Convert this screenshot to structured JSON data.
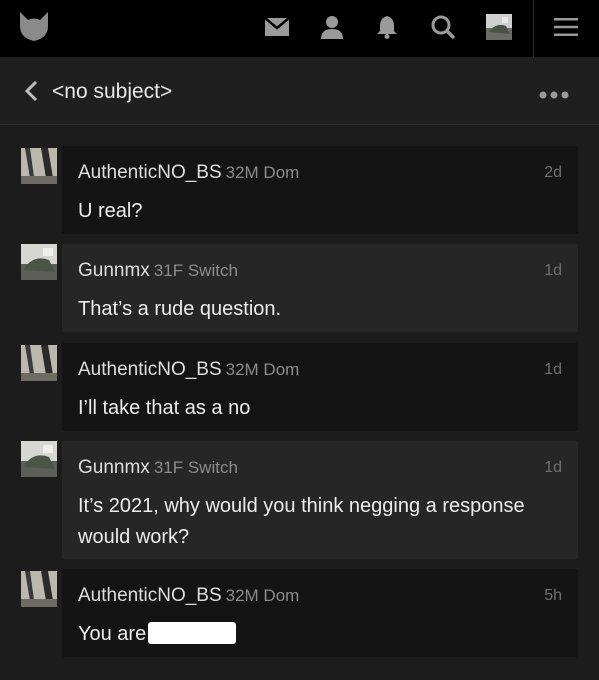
{
  "nav": {
    "icons": [
      "logo-icon",
      "mail-icon",
      "user-icon",
      "bell-icon",
      "search-icon",
      "avatar-thumbnail",
      "menu-icon"
    ]
  },
  "header": {
    "subject": "<no subject>"
  },
  "messages": [
    {
      "username": "AuthenticNO_BS",
      "meta": "32M Dom",
      "time": "2d",
      "text": "U real?"
    },
    {
      "username": "Gunnmx",
      "meta": "31F Switch",
      "time": "1d",
      "text": "That’s a rude question."
    },
    {
      "username": "AuthenticNO_BS",
      "meta": "32M Dom",
      "time": "1d",
      "text": "I’ll take that as a no"
    },
    {
      "username": "Gunnmx",
      "meta": "31F Switch",
      "time": "1d",
      "text": "It’s 2021, why would you think negging a response would work?"
    },
    {
      "username": "AuthenticNO_BS",
      "meta": "32M Dom",
      "time": "5h",
      "text": "You are"
    }
  ],
  "colors": {
    "nav_bg": "#000000",
    "page_bg": "#1c1c1c",
    "their_bubble": "#141414",
    "my_bubble": "#262626",
    "icon": "#9a9a9a"
  }
}
